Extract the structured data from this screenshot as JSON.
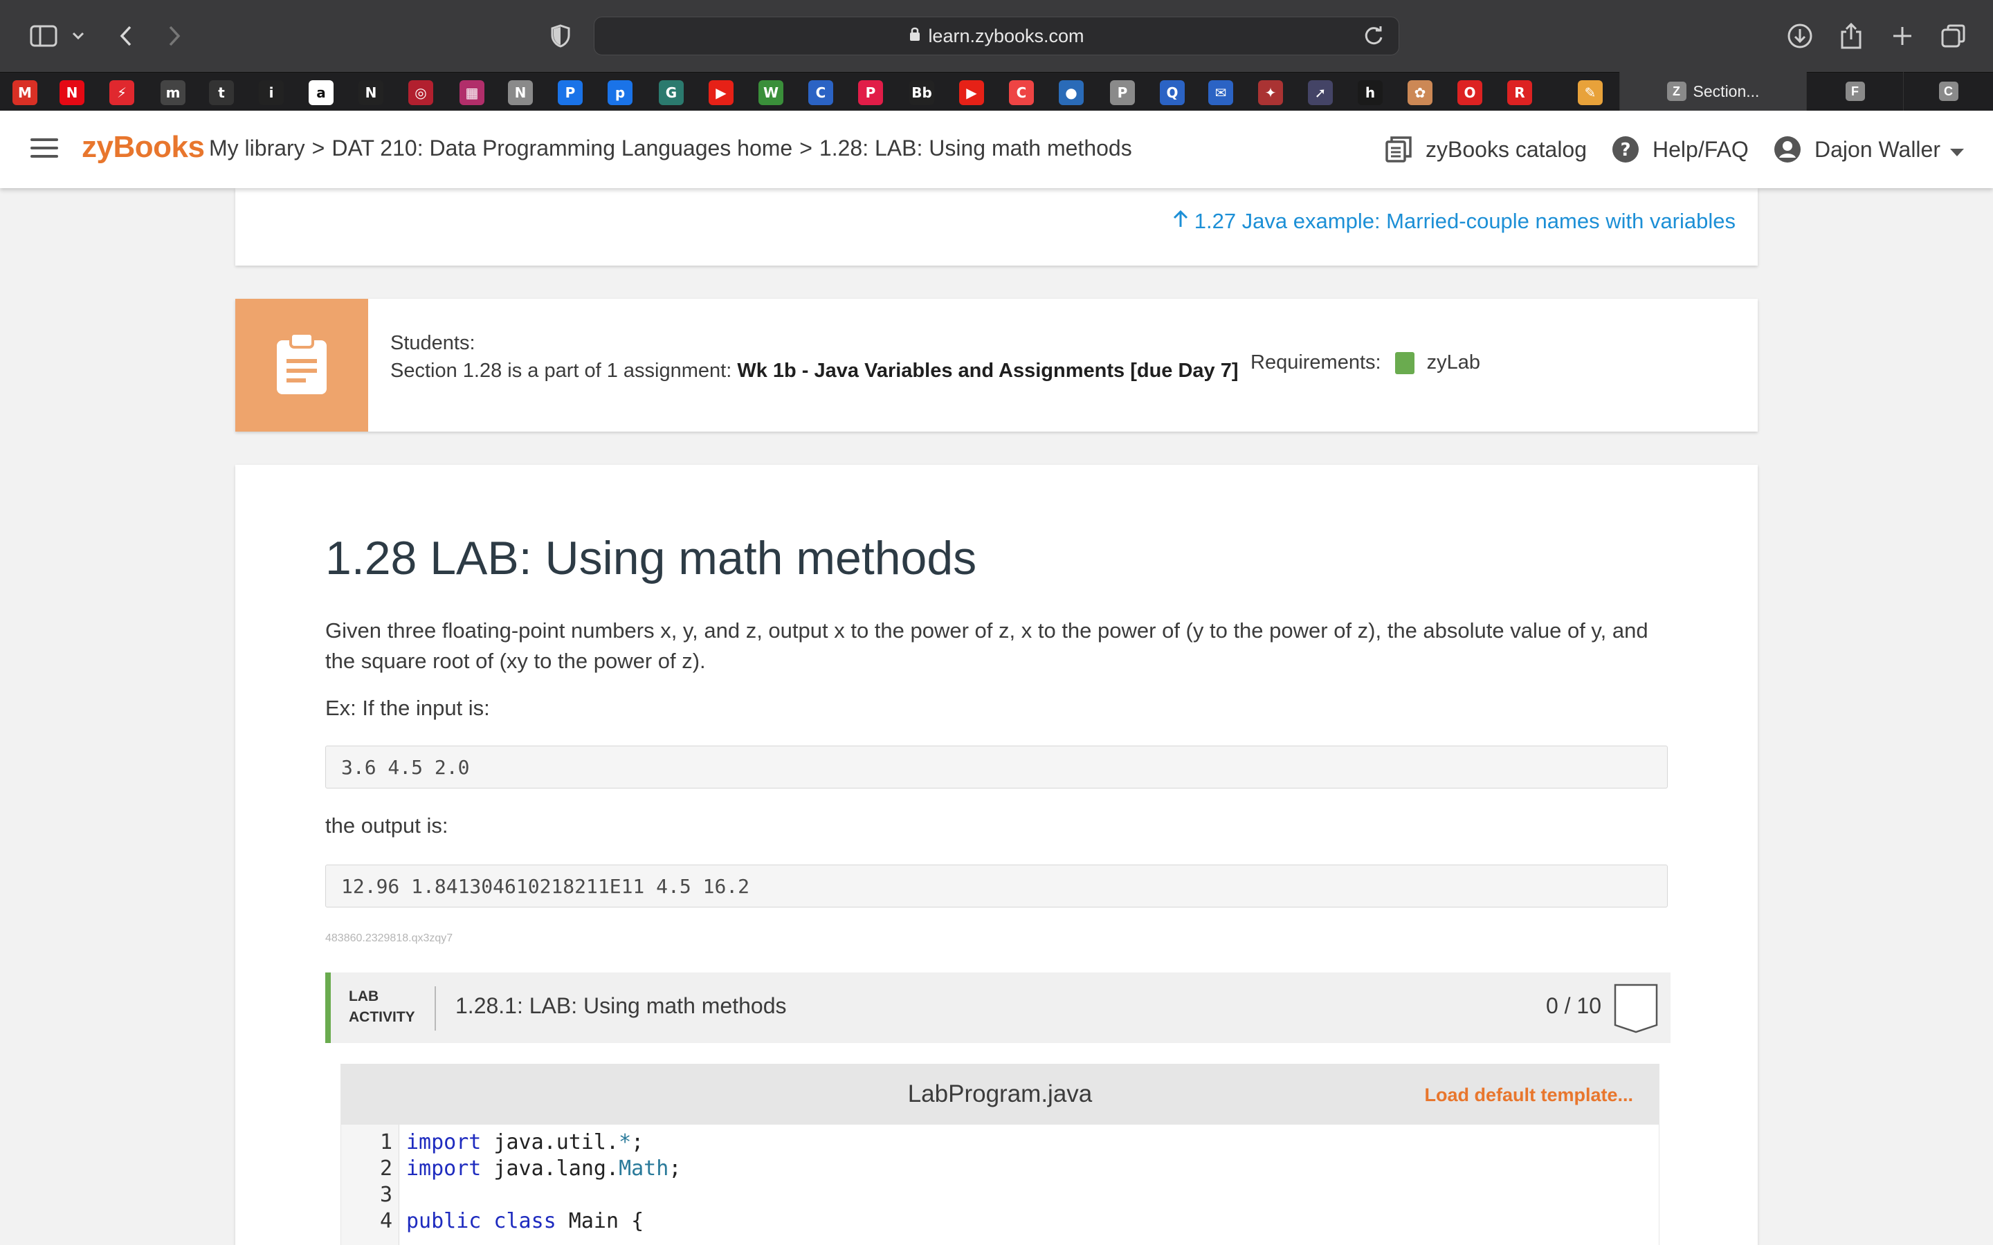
{
  "browser": {
    "url": "learn.zybooks.com",
    "tabs": [
      {
        "label": "Section...",
        "favicon": "Z",
        "active": true
      },
      {
        "label": "",
        "favicon": "F",
        "active": false
      },
      {
        "label": "",
        "favicon": "C",
        "active": false
      }
    ],
    "bookmarks": [
      {
        "icon": "gmail-icon",
        "glyph": "M",
        "color": "#d93025"
      },
      {
        "icon": "netflix-icon",
        "glyph": "N",
        "color": "#e50914"
      },
      {
        "icon": "bolt-icon",
        "glyph": "⚡",
        "color": "#e0282e"
      },
      {
        "icon": "m-icon",
        "glyph": "m",
        "color": "#444"
      },
      {
        "icon": "t-icon",
        "glyph": "t",
        "color": "#333"
      },
      {
        "icon": "info-icon",
        "glyph": "i",
        "color": "#222"
      },
      {
        "icon": "amazon-icon",
        "glyph": "a",
        "color": "#fff"
      },
      {
        "icon": "nova-icon",
        "glyph": "N",
        "color": "#222"
      },
      {
        "icon": "target-icon",
        "glyph": "◎",
        "color": "#b2202f"
      },
      {
        "icon": "grid-icon",
        "glyph": "▦",
        "color": "#b12e6a"
      },
      {
        "icon": "n-icon",
        "glyph": "N",
        "color": "#8a8a8a"
      },
      {
        "icon": "p-icon",
        "glyph": "P",
        "color": "#1a73e8"
      },
      {
        "icon": "p2-icon",
        "glyph": "p",
        "color": "#1a73e8"
      },
      {
        "icon": "gls-icon",
        "glyph": "G",
        "color": "#2b7a6e"
      },
      {
        "icon": "youtube-icon",
        "glyph": "▶",
        "color": "#e62117"
      },
      {
        "icon": "w-icon",
        "glyph": "W",
        "color": "#3a8f3a"
      },
      {
        "icon": "c-icon",
        "glyph": "C",
        "color": "#2b63c4"
      },
      {
        "icon": "pearson-icon",
        "glyph": "P",
        "color": "#e11d48"
      },
      {
        "icon": "blackboard-icon",
        "glyph": "Bb",
        "color": "#222"
      },
      {
        "icon": "youtube2-icon",
        "glyph": "▶",
        "color": "#e62117"
      },
      {
        "icon": "c2-icon",
        "glyph": "C",
        "color": "#e44"
      },
      {
        "icon": "dots-icon",
        "glyph": "●",
        "color": "#2a6bb8"
      },
      {
        "icon": "p3-icon",
        "glyph": "P",
        "color": "#8a8a8a"
      },
      {
        "icon": "q-icon",
        "glyph": "Q",
        "color": "#2b63c4"
      },
      {
        "icon": "mail-icon",
        "glyph": "✉",
        "color": "#2b63c4"
      },
      {
        "icon": "bird-icon",
        "glyph": "✦",
        "color": "#a33"
      },
      {
        "icon": "arrow-icon",
        "glyph": "➚",
        "color": "#446"
      },
      {
        "icon": "h-icon",
        "glyph": "h",
        "color": "#1a1a1a"
      },
      {
        "icon": "flower-icon",
        "glyph": "✿",
        "color": "#c85"
      },
      {
        "icon": "o-icon",
        "glyph": "O",
        "color": "#d22"
      },
      {
        "icon": "r-icon",
        "glyph": "R",
        "color": "#d22"
      },
      {
        "icon": "pencil-icon",
        "glyph": "✎",
        "color": "#e8a23a"
      }
    ]
  },
  "header": {
    "logo": "zyBooks",
    "breadcrumb": {
      "library": "My library",
      "sep1": ">",
      "course": "DAT 210: Data Programming Languages home",
      "sep2": ">",
      "section": "1.28: LAB: Using math methods"
    },
    "catalog": "zyBooks catalog",
    "help": "Help/FAQ",
    "user": "Dajon Waller"
  },
  "prev_link": "1.27 Java example: Married-couple names with variables",
  "assignment": {
    "students_label": "Students:",
    "prefix": "Section 1.28 is a part of 1 assignment: ",
    "name": "Wk 1b - Java Variables and Assignments [due Day 7]",
    "requirements_label": "Requirements:",
    "requirement": "zyLab",
    "accent": "#eea46c"
  },
  "section": {
    "title": "1.28 LAB: Using math methods",
    "description": "Given three floating-point numbers x, y, and z, output x to the power of z, x to the power of (y to the power of z), the absolute value of y, and the square root of (xy to the power of z).",
    "example_intro": "Ex: If the input is:",
    "example_input": "3.6 4.5 2.0",
    "output_intro": "the output is:",
    "example_output": "12.96 1.841304610218211E11 4.5 16.2",
    "id_tag": "483860.2329818.qx3zqy7"
  },
  "lab": {
    "label_line1": "LAB",
    "label_line2": "ACTIVITY",
    "title": "1.28.1: LAB: Using math methods",
    "score": "0 / 10",
    "accent": "#6aab4f"
  },
  "editor": {
    "file": "LabProgram.java",
    "load_default": "Load default template...",
    "lines": [
      {
        "n": "1",
        "kw": "import",
        "rest": " java.util.",
        "cls": "*",
        "end": ";"
      },
      {
        "n": "2",
        "kw": "import",
        "rest": " java.lang.",
        "cls": "Math",
        "end": ";"
      },
      {
        "n": "3",
        "kw": "",
        "rest": "",
        "cls": "",
        "end": ""
      },
      {
        "n": "4",
        "kw": "public class",
        "rest": " Main ",
        "cls": "",
        "end": "{"
      }
    ]
  }
}
